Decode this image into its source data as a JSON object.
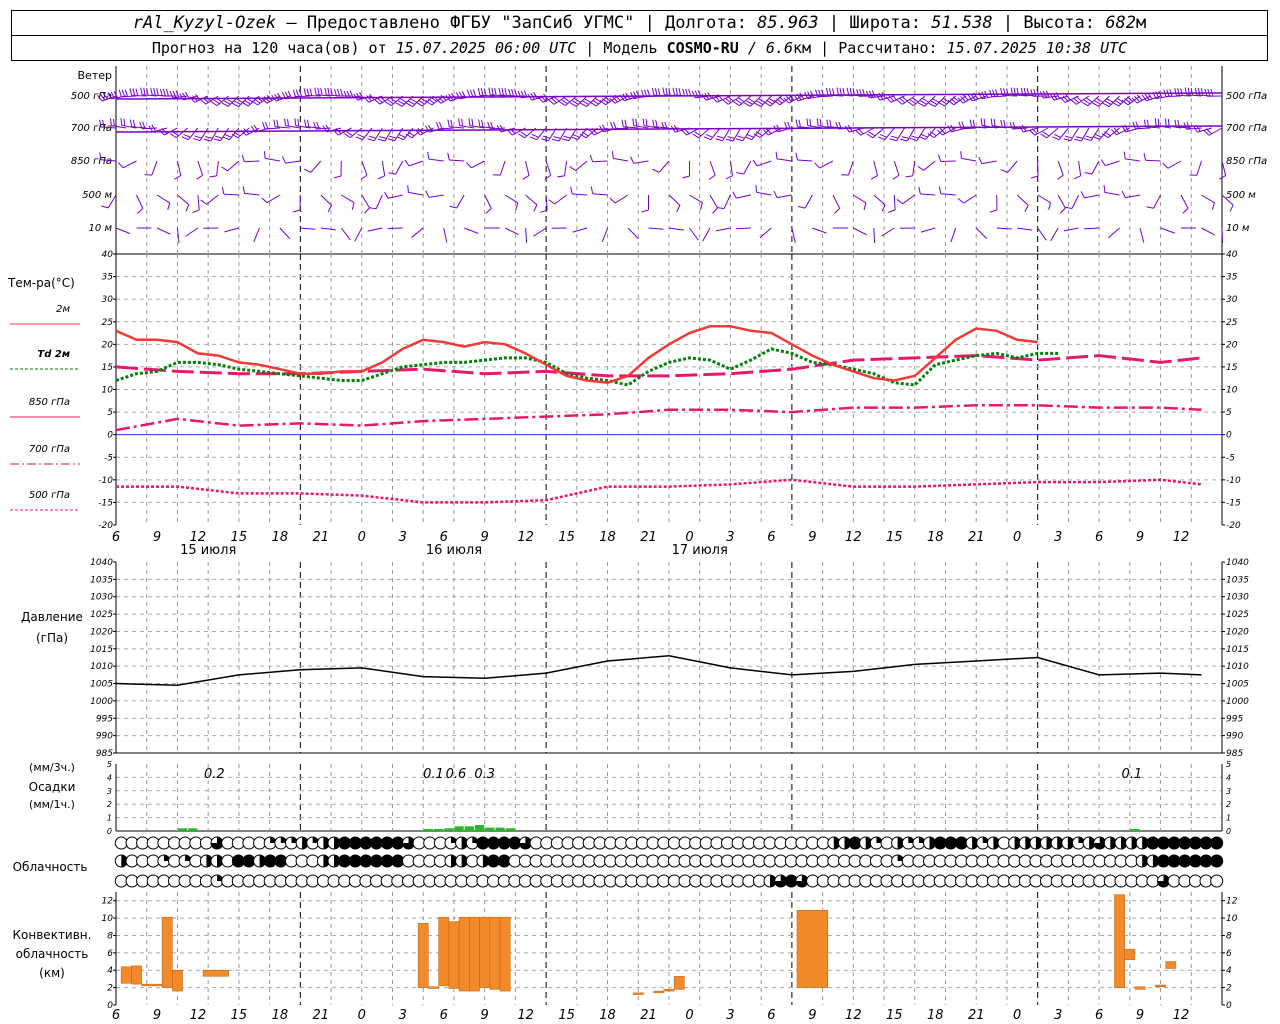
{
  "header": {
    "station": "rAl_Kyzyl-Ozek",
    "dash": " — ",
    "provider": "Предоставлено ФГБУ \"ЗапСиб УГМС\"",
    "sep": " | ",
    "lon_label": "Долгота: ",
    "lon_value": "85.963",
    "lat_label": "Широта: ",
    "lat_value": "51.538",
    "alt_label": "Высота: ",
    "alt_value": "682",
    "alt_unit": "м",
    "forecast_prefix": "Прогноз на 120 часа(ов) от ",
    "forecast_time": "15.07.2025 06:00 UTC",
    "model_label": "Модель ",
    "model_name": "COSMO-RU",
    "model_res": " / 6.6",
    "model_res_unit": "км",
    "calc_label": "Рассчитано: ",
    "calc_time": "15.07.2025 10:38 UTC"
  },
  "colors": {
    "t2m": "#f03a3a",
    "td2m": "#00800a",
    "t850": "#e8186e",
    "t700": "#e8186e",
    "t500": "#e8186e",
    "wind": "#7a00c8",
    "zero_line": "#3030ff",
    "pressure": "#000000",
    "precip": "#2bb52b",
    "convective": "#f08a2a"
  },
  "chart_data": [
    {
      "type": "wind_barbs",
      "title": "Ветер",
      "levels": [
        "500 гПа",
        "700 гПа",
        "850 гПа",
        "500 м",
        "10 м"
      ]
    },
    {
      "type": "line",
      "ylabel": "Тем-ра(°C)",
      "ylim": [
        -20,
        40
      ],
      "yticks": [
        -20,
        -15,
        -10,
        -5,
        0,
        5,
        10,
        15,
        20,
        25,
        30,
        35,
        40
      ],
      "grid": true,
      "legend_position": "left",
      "series": [
        {
          "name": "2м",
          "hours": [
            0,
            2,
            4,
            6,
            8,
            10,
            12,
            14,
            16,
            18,
            20,
            22,
            24,
            26,
            28,
            30,
            32,
            34,
            36,
            38,
            40,
            42,
            44,
            46,
            48,
            50,
            52,
            54,
            56,
            58,
            60,
            62,
            64,
            66,
            68,
            70,
            72,
            74,
            76,
            78,
            80,
            82,
            84,
            86,
            88,
            90,
            92,
            94,
            96,
            98,
            100,
            102,
            104,
            106
          ],
          "values": [
            23,
            21,
            21,
            20.5,
            18,
            17.5,
            16,
            15.5,
            14.5,
            13.5,
            13.5,
            14,
            14,
            16,
            19,
            21,
            20.5,
            19.5,
            20.5,
            20,
            18,
            15.5,
            13,
            12,
            11.5,
            13,
            17,
            20,
            22.5,
            24,
            24,
            23,
            22.5,
            20,
            17.5,
            15.5,
            14,
            12.5,
            12,
            13,
            17,
            21,
            23.5,
            23,
            21,
            20.5
          ]
        },
        {
          "name": "Td 2м",
          "hours": [
            0,
            2,
            4,
            6,
            8,
            10,
            12,
            14,
            16,
            18,
            20,
            22,
            24,
            26,
            28,
            30,
            32,
            34,
            36,
            38,
            40,
            42,
            44,
            46,
            48,
            50,
            52,
            54,
            56,
            58,
            60,
            62,
            64,
            66,
            68,
            70,
            72,
            74,
            76,
            78,
            80,
            82,
            84,
            86,
            88,
            90,
            92,
            94,
            96,
            98,
            100,
            102,
            104,
            106
          ],
          "values": [
            12,
            13.5,
            14,
            16,
            16,
            15.5,
            14.5,
            14,
            13.5,
            13,
            12.5,
            12,
            12,
            13.5,
            15,
            15.5,
            16,
            16,
            16.5,
            17,
            17,
            16,
            13.5,
            12.5,
            12,
            11,
            14,
            16,
            17,
            16.5,
            14.5,
            16.5,
            19,
            18,
            16,
            15.5,
            14.5,
            13.5,
            11.5,
            11,
            15.5,
            16.5,
            17.5,
            18,
            17,
            18,
            18
          ]
        },
        {
          "name": "850 гПа",
          "hours": [
            0,
            6,
            12,
            18,
            24,
            30,
            36,
            42,
            48,
            54,
            60,
            66,
            72,
            78,
            84,
            90,
            96,
            102,
            106
          ],
          "values": [
            15,
            14,
            13.5,
            13.5,
            14,
            14.5,
            13.5,
            14,
            13,
            13,
            13.5,
            14.5,
            16.5,
            17,
            17.5,
            16.5,
            17.5,
            16,
            17
          ]
        },
        {
          "name": "700 гПа",
          "hours": [
            0,
            6,
            12,
            18,
            24,
            30,
            36,
            42,
            48,
            54,
            60,
            66,
            72,
            78,
            84,
            90,
            96,
            102,
            106
          ],
          "values": [
            1,
            3.5,
            2,
            2.5,
            2,
            3,
            3.5,
            4,
            4.5,
            5.5,
            5.5,
            5,
            6,
            6,
            6.5,
            6.5,
            6,
            6,
            5.5
          ]
        },
        {
          "name": "500 гПа",
          "hours": [
            0,
            6,
            12,
            18,
            24,
            30,
            36,
            42,
            48,
            54,
            60,
            66,
            72,
            78,
            84,
            90,
            96,
            102,
            106
          ],
          "values": [
            -11.5,
            -11.5,
            -13,
            -13,
            -13.5,
            -15,
            -15,
            -14.5,
            -11.5,
            -11.5,
            -11,
            -10,
            -11.5,
            -11.5,
            -11,
            -10.5,
            -10.5,
            -10,
            -11
          ]
        }
      ]
    },
    {
      "type": "line",
      "ylabel": "Давление",
      "yunit": "(гПа)",
      "ylim": [
        985,
        1040
      ],
      "yticks": [
        985,
        990,
        995,
        1000,
        1005,
        1010,
        1015,
        1020,
        1025,
        1030,
        1035,
        1040
      ],
      "grid": true,
      "series": [
        {
          "name": "",
          "hours": [
            0,
            6,
            12,
            18,
            24,
            30,
            36,
            42,
            48,
            54,
            60,
            66,
            72,
            78,
            84,
            90,
            96,
            102,
            106
          ],
          "values": [
            1005,
            1004.5,
            1007.5,
            1009,
            1009.5,
            1007,
            1006.5,
            1008,
            1011.5,
            1013,
            1009.5,
            1007.5,
            1008.5,
            1010.5,
            1011.5,
            1012.5,
            1007.5,
            1008,
            1007.5
          ]
        }
      ]
    },
    {
      "type": "bar",
      "ylabel_top": "(мм/3ч.)",
      "ylabel": "Осадки",
      "ylabel_bottom": "(мм/1ч.)",
      "ylim": [
        0,
        5
      ],
      "yticks": [
        0,
        1,
        2,
        3,
        4,
        5
      ],
      "labels": [
        {
          "hour": 9.6,
          "text": "0.2"
        },
        {
          "hour": 31,
          "text": "0.1"
        },
        {
          "hour": 33.2,
          "text": "0.6"
        },
        {
          "hour": 36,
          "text": "0.3"
        },
        {
          "hour": 99.2,
          "text": "0.1"
        }
      ],
      "bars": [
        {
          "hour": 6,
          "value": 0.2
        },
        {
          "hour": 7,
          "value": 0.2
        },
        {
          "hour": 30,
          "value": 0.15
        },
        {
          "hour": 31,
          "value": 0.15
        },
        {
          "hour": 32,
          "value": 0.2
        },
        {
          "hour": 33,
          "value": 0.35
        },
        {
          "hour": 34,
          "value": 0.35
        },
        {
          "hour": 35,
          "value": 0.45
        },
        {
          "hour": 36,
          "value": 0.25
        },
        {
          "hour": 37,
          "value": 0.25
        },
        {
          "hour": 38,
          "value": 0.2
        },
        {
          "hour": 99,
          "value": 0.15
        }
      ]
    },
    {
      "type": "table",
      "ylabel": "Облачность",
      "rows": [
        "00000000030000111212244444430001214444300000000000000000000000000002242102112444212022222212322224444444",
        "20001010220442440002244444400002202440000000000000000000000000000000000001000000000000000000000022444444",
        "00000000010000000000000000000000000000000000000000000000000002343000000000000000000000000000000000300000"
      ]
    },
    {
      "type": "bar",
      "ylabel": "Конвективн.",
      "ylabel2": "облачность",
      "yunit": "(км)",
      "ylim": [
        0,
        13
      ],
      "yticks": [
        0,
        2,
        4,
        6,
        8,
        10,
        12
      ],
      "bars": [
        {
          "h0": 0.5,
          "h1": 1.5,
          "bottom": 2.5,
          "top": 4.4
        },
        {
          "h0": 1.5,
          "h1": 2.5,
          "bottom": 2.4,
          "top": 4.5
        },
        {
          "h0": 2.5,
          "h1": 4.5,
          "bottom": 2.2,
          "top": 2.4
        },
        {
          "h0": 4.5,
          "h1": 5.5,
          "bottom": 2,
          "top": 10.1
        },
        {
          "h0": 5.5,
          "h1": 6.5,
          "bottom": 1.6,
          "top": 4
        },
        {
          "h0": 8.5,
          "h1": 11,
          "bottom": 3.3,
          "top": 4
        },
        {
          "h0": 29.5,
          "h1": 30.5,
          "bottom": 2,
          "top": 9.4
        },
        {
          "h0": 30.5,
          "h1": 31.5,
          "bottom": 1.9,
          "top": 2.1
        },
        {
          "h0": 31.5,
          "h1": 32.5,
          "bottom": 2.2,
          "top": 10.1
        },
        {
          "h0": 32.5,
          "h1": 33.5,
          "bottom": 1.9,
          "top": 9.6
        },
        {
          "h0": 33.5,
          "h1": 34.5,
          "bottom": 1.6,
          "top": 10.1
        },
        {
          "h0": 34.5,
          "h1": 35.5,
          "bottom": 1.6,
          "top": 10.1
        },
        {
          "h0": 35.5,
          "h1": 36.5,
          "bottom": 2,
          "top": 10.1
        },
        {
          "h0": 36.5,
          "h1": 37.5,
          "bottom": 1.8,
          "top": 10.1
        },
        {
          "h0": 37.5,
          "h1": 38.5,
          "bottom": 1.6,
          "top": 10.1
        },
        {
          "h0": 50.5,
          "h1": 51.5,
          "bottom": 1.2,
          "top": 1.4
        },
        {
          "h0": 52.5,
          "h1": 53.5,
          "bottom": 1.4,
          "top": 1.6
        },
        {
          "h0": 53.5,
          "h1": 54.5,
          "bottom": 1.6,
          "top": 1.8
        },
        {
          "h0": 54.5,
          "h1": 55.5,
          "bottom": 1.8,
          "top": 3.3
        },
        {
          "h0": 66.5,
          "h1": 69.5,
          "bottom": 2,
          "top": 10.9
        },
        {
          "h0": 97.5,
          "h1": 98.5,
          "bottom": 2,
          "top": 12.7
        },
        {
          "h0": 98.5,
          "h1": 99.5,
          "bottom": 5.2,
          "top": 6.4
        },
        {
          "h0": 99.5,
          "h1": 100.5,
          "bottom": 1.8,
          "top": 2.1
        },
        {
          "h0": 101.5,
          "h1": 102.5,
          "bottom": 2.1,
          "top": 2.3
        },
        {
          "h0": 102.5,
          "h1": 103.5,
          "bottom": 4.2,
          "top": 5
        }
      ]
    }
  ],
  "x_axis": {
    "tick_labels": [
      "6",
      "9",
      "12",
      "15",
      "18",
      "21",
      "0",
      "3",
      "6",
      "9",
      "12",
      "15",
      "18",
      "21",
      "0",
      "3",
      "6",
      "9",
      "12",
      "15",
      "18",
      "21",
      "0",
      "3",
      "6",
      "9",
      "12"
    ],
    "days": [
      {
        "label": "15 июля",
        "hour": 9
      },
      {
        "label": "16 июля",
        "hour": 33
      },
      {
        "label": "17 июля",
        "hour": 57
      }
    ]
  }
}
